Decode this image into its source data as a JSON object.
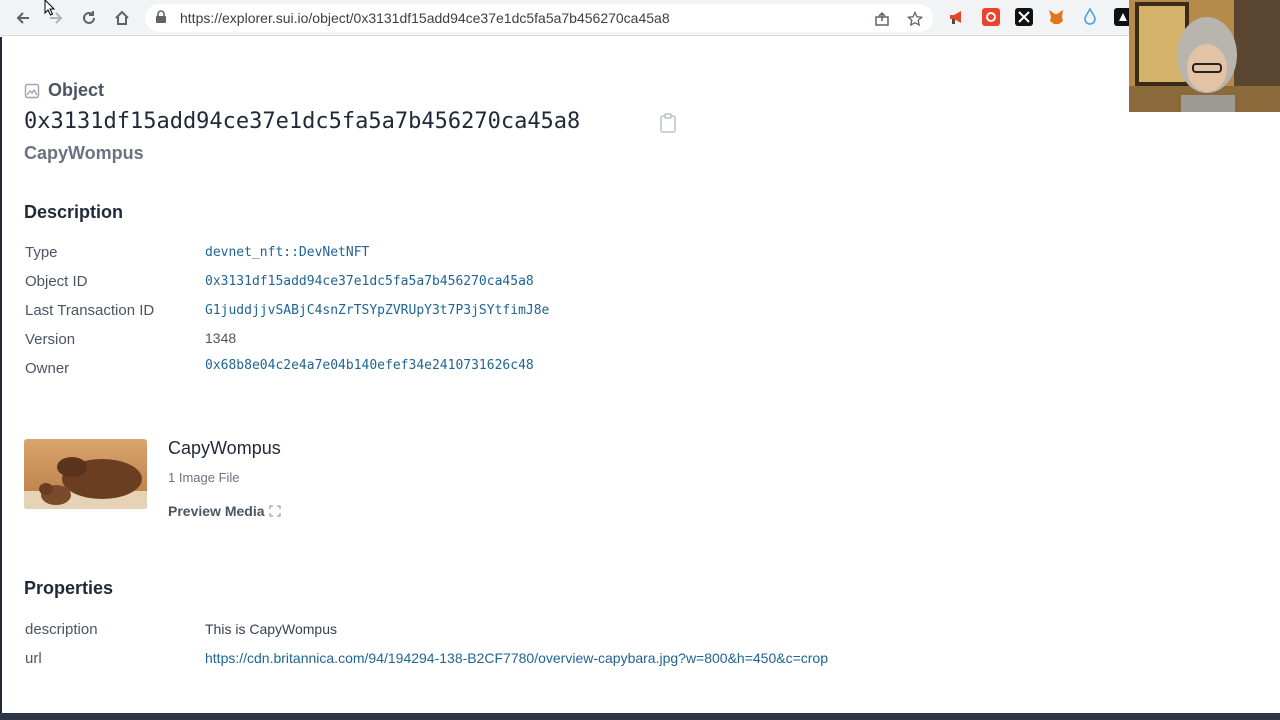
{
  "browser": {
    "url": "https://explorer.sui.io/object/0x3131df15add94ce37e1dc5fa5a7b456270ca45a8"
  },
  "header": {
    "label": "Object",
    "object_id": "0x3131df15add94ce37e1dc5fa5a7b456270ca45a8",
    "name": "CapyWompus"
  },
  "description": {
    "title": "Description",
    "rows": [
      {
        "key": "Type",
        "value": "devnet_nft::DevNetNFT"
      },
      {
        "key": "Object ID",
        "value": "0x3131df15add94ce37e1dc5fa5a7b456270ca45a8"
      },
      {
        "key": "Last Transaction ID",
        "value": "G1juddjjvSABjC4snZrTSYpZVRUpY3t7P3jSYtfimJ8e"
      },
      {
        "key": "Version",
        "value": "1348"
      },
      {
        "key": "Owner",
        "value": "0x68b8e04c2e4a7e04b140efef34e2410731626c48"
      }
    ]
  },
  "media": {
    "title": "CapyWompus",
    "subtitle": "1 Image File",
    "preview_label": "Preview Media"
  },
  "properties": {
    "title": "Properties",
    "rows": [
      {
        "key": "description",
        "value": "This is CapyWompus"
      },
      {
        "key": "url",
        "value": "https://cdn.britannica.com/94/194294-138-B2CF7780/overview-capybara.jpg?w=800&h=450&c=crop"
      }
    ]
  },
  "colors": {
    "link": "#1f6493",
    "extension_red": "#e8452c",
    "extension_blue": "#4aa3df",
    "metamask": "#e2761b"
  }
}
